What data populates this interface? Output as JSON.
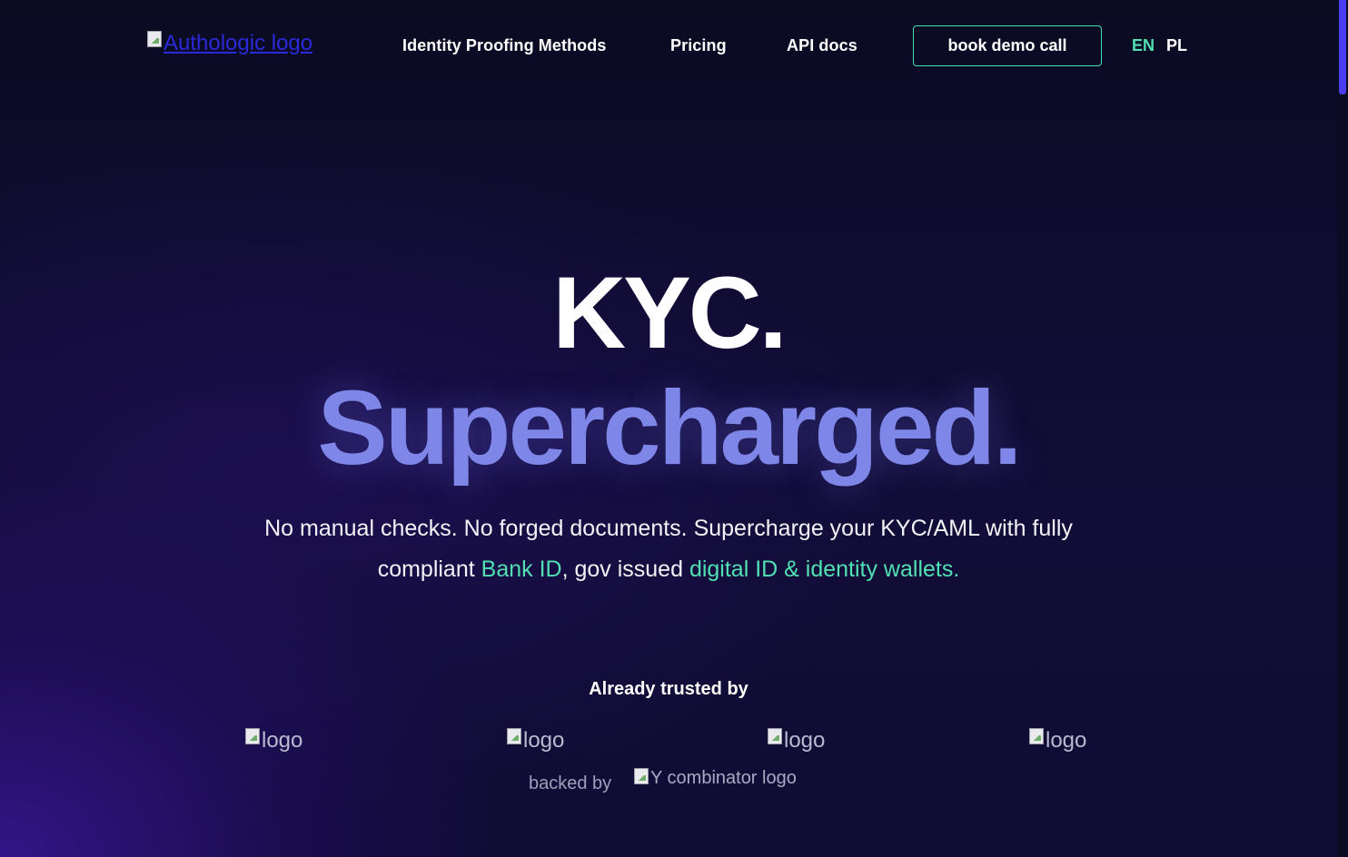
{
  "header": {
    "logo_alt": "Authologic logo",
    "nav": [
      {
        "label": "Identity Proofing Methods"
      },
      {
        "label": "Pricing"
      },
      {
        "label": "API docs"
      }
    ],
    "cta_label": "book demo call",
    "languages": [
      {
        "label": "EN",
        "active": true
      },
      {
        "label": "PL",
        "active": false
      }
    ]
  },
  "hero": {
    "title_line1": "KYC.",
    "title_line2": "Supercharged.",
    "subtitle_part1": "No manual checks. No forged documents. Supercharge your KYC/AML with fully compliant ",
    "subtitle_link1": "Bank ID",
    "subtitle_part2": ", gov issued ",
    "subtitle_link2": "digital ID & identity wallets."
  },
  "trusted": {
    "heading": "Already trusted by",
    "logos": [
      {
        "alt": "logo"
      },
      {
        "alt": "logo"
      },
      {
        "alt": "logo"
      },
      {
        "alt": "logo"
      }
    ],
    "backed_by_label": "backed by",
    "backer_logo_alt": "Y combinator logo"
  },
  "colors": {
    "accent": "#52e0b2",
    "headline_secondary": "#7e86e8",
    "background": "#0b0b24",
    "scrollbar_thumb": "#4a3df0"
  }
}
